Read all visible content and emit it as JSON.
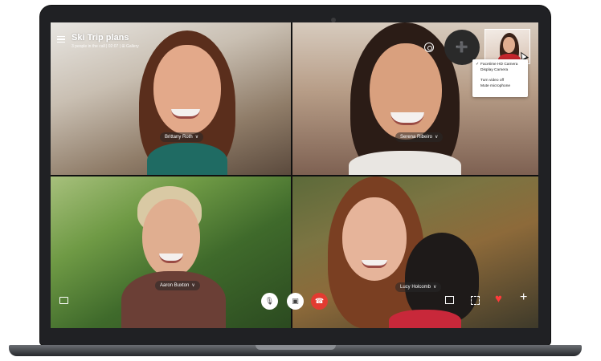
{
  "call": {
    "title": "Ski Trip plans",
    "subtitle": "3 people in the call | 02:07 | ⊞ Gallery"
  },
  "participants": [
    {
      "name": "Brittany Roth"
    },
    {
      "name": "Serena Ribeiro"
    },
    {
      "name": "Aaron Buxton"
    },
    {
      "name": "Lucy Holcomb"
    }
  ],
  "camera_menu": {
    "items": [
      {
        "label": "Facetime HD Camera",
        "checked": true
      },
      {
        "label": "Display Camera",
        "checked": false
      },
      {
        "label": "Turn video off",
        "checked": false
      },
      {
        "label": "Mute microphone",
        "checked": false
      }
    ],
    "check_mark": "✓"
  },
  "controls": {
    "mic_glyph": "🎙",
    "video_glyph": "▣",
    "hangup_glyph": "☎",
    "add_person_glyph": "➕",
    "heart_glyph": "♥",
    "plus_glyph": "+",
    "chevron_glyph": "∨"
  },
  "colors": {
    "hangup": "#e23b31",
    "heart": "#ff3b3b"
  },
  "icons": [
    "menu-icon",
    "gear-icon",
    "add-person-icon",
    "chat-icon",
    "mic-icon",
    "video-icon",
    "hangup-icon",
    "screenshare-icon",
    "focus-icon",
    "heart-icon",
    "plus-icon",
    "cursor-icon"
  ]
}
